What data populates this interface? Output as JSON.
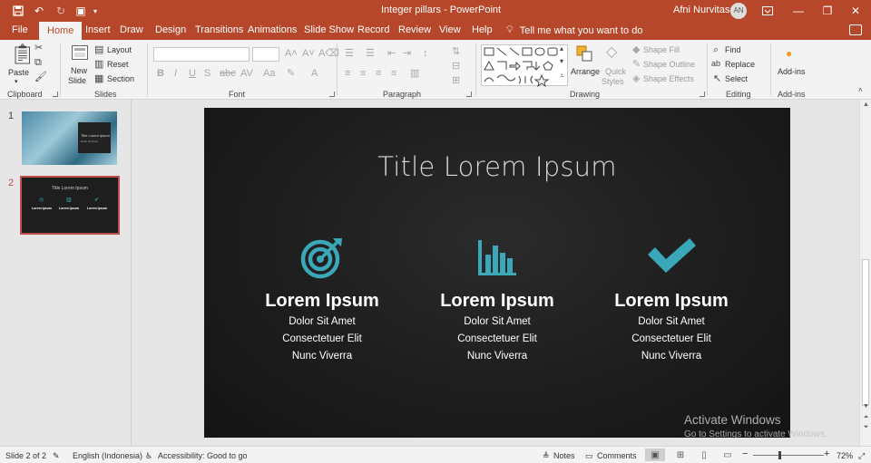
{
  "app": {
    "doc_title": "Integer pillars  -  PowerPoint",
    "user_name": "Afni Nurvitasari",
    "user_initials": "AN"
  },
  "tabs": [
    "File",
    "Home",
    "Insert",
    "Draw",
    "Design",
    "Transitions",
    "Animations",
    "Slide Show",
    "Record",
    "Review",
    "View",
    "Help"
  ],
  "tell_me": "Tell me what you want to do",
  "ribbon": {
    "clipboard": {
      "paste": "Paste",
      "label": "Clipboard"
    },
    "slides": {
      "new_slide_1": "New",
      "new_slide_2": "Slide",
      "layout": "Layout",
      "reset": "Reset",
      "section": "Section",
      "label": "Slides"
    },
    "font": {
      "label": "Font"
    },
    "paragraph": {
      "label": "Paragraph"
    },
    "drawing": {
      "arrange": "Arrange",
      "quick_styles_1": "Quick",
      "quick_styles_2": "Styles",
      "shape_fill": "Shape Fill",
      "shape_outline": "Shape Outline",
      "shape_effects": "Shape Effects",
      "label": "Drawing"
    },
    "editing": {
      "find": "Find",
      "replace": "Replace",
      "select": "Select",
      "label": "Editing"
    },
    "addins": {
      "button": "Add-ins",
      "label": "Add-ins"
    }
  },
  "thumbnails": {
    "slide1": {
      "number": "1",
      "title": "Title Lorem Ipsum",
      "subtitle": "Dolor Sit Amet"
    },
    "slide2": {
      "number": "2",
      "title": "Title Lorem Ipsum",
      "heading": "Lorem Ipsum"
    }
  },
  "slide": {
    "title": "Title Lorem Ipsum",
    "pillars": [
      {
        "icon": "target-icon",
        "heading": "Lorem Ipsum",
        "lines": [
          "Dolor Sit Amet",
          "Consectetuer Elit",
          "Nunc Viverra"
        ]
      },
      {
        "icon": "bar-chart-icon",
        "heading": "Lorem Ipsum",
        "lines": [
          "Dolor Sit Amet",
          "Consectetuer Elit",
          "Nunc Viverra"
        ]
      },
      {
        "icon": "checkmark-icon",
        "heading": "Lorem Ipsum",
        "lines": [
          "Dolor Sit Amet",
          "Consectetuer Elit",
          "Nunc Viverra"
        ]
      }
    ],
    "icon_color": "#3aa8b8"
  },
  "watermark": {
    "line1": "Activate Windows",
    "line2": "Go to Settings to activate Windows."
  },
  "status": {
    "slide_count": "Slide 2 of 2",
    "language": "English (Indonesia)",
    "accessibility": "Accessibility: Good to go",
    "notes": "Notes",
    "comments": "Comments",
    "zoom": "72%"
  },
  "colors": {
    "accent": "#b7472a",
    "selected_thumb_border": "#c0504d"
  }
}
